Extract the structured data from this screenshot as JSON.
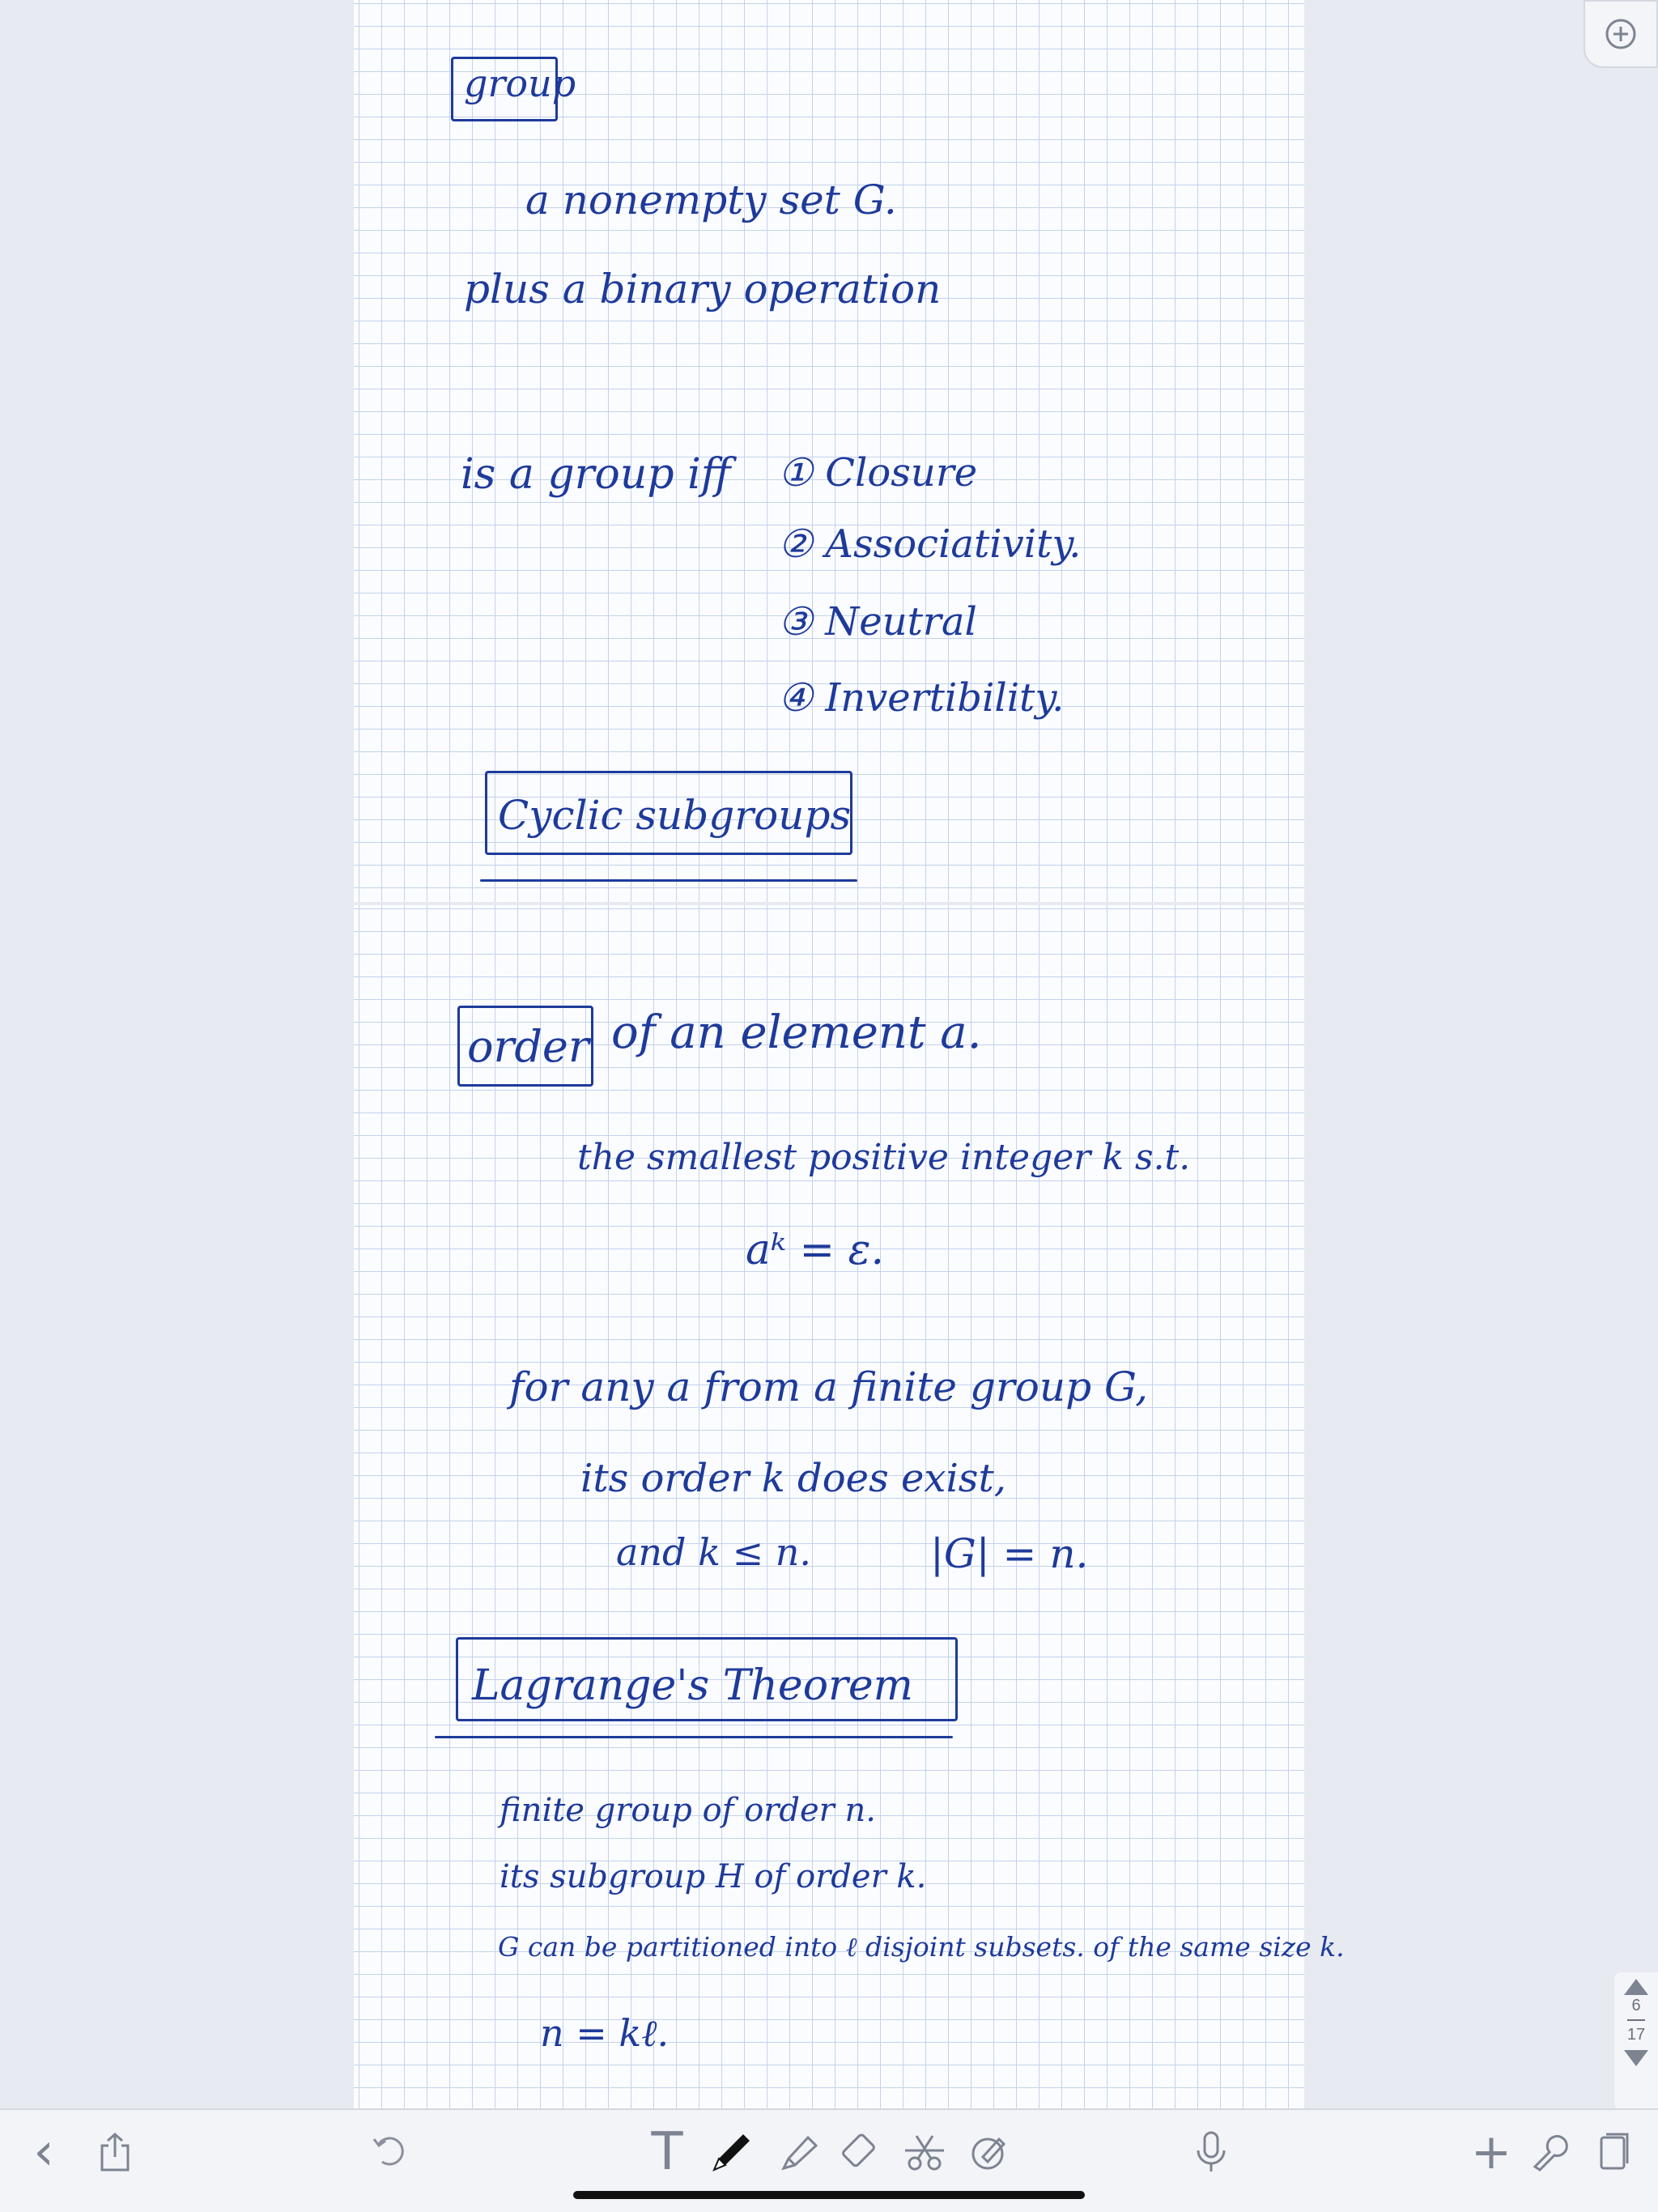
{
  "notes": {
    "group_heading": "group",
    "group_line1": "a nonempty set G.",
    "group_line2": "plus a binary operation",
    "group_iff": "is a group iff",
    "axioms": [
      "① Closure",
      "② Associativity.",
      "③ Neutral",
      "④ Invertibility."
    ],
    "cyclic_heading": "Cyclic subgroups",
    "order_heading": "order",
    "order_rest": "of an element a.",
    "order_def": "the smallest positive integer k s.t.",
    "order_eq": "aᵏ = ε.",
    "finite_line1": "for any a from a finite group G,",
    "finite_line2": "its order k does exist,",
    "finite_line3": "and k ≤ n.",
    "finite_line3b": "|G| = n.",
    "lagrange_heading": "Lagrange's Theorem",
    "lagrange_line1": "finite group of order n.",
    "lagrange_line2": "its subgroup H of order k.",
    "lagrange_line3": "G can be partitioned into ℓ disjoint subsets. of the same size k.",
    "lagrange_line4": "n = kℓ."
  },
  "page_nav": {
    "current": "6",
    "total": "17"
  },
  "toolbar": {
    "back_glyph": "‹",
    "text_tool_glyph": "T",
    "add_glyph": "+"
  },
  "colors": {
    "ink": "#1e3a9a",
    "grid": "#c3d2ec",
    "toolbar_bg": "#f3f4f7",
    "icon": "#7d8391"
  }
}
